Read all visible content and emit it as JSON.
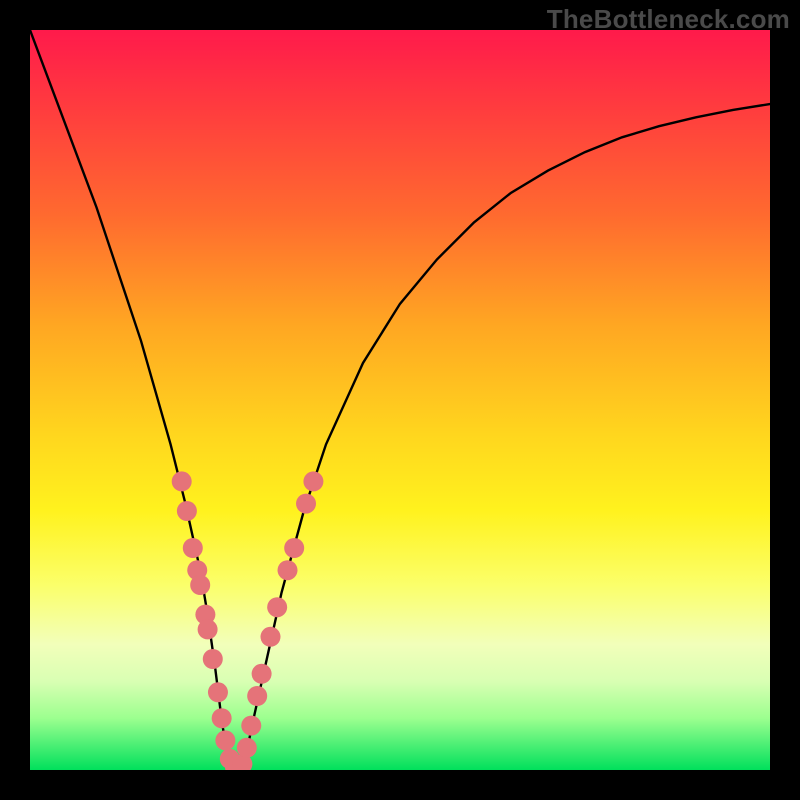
{
  "watermark": "TheBottleneck.com",
  "chart_data": {
    "type": "line",
    "title": "",
    "xlabel": "",
    "ylabel": "",
    "xlim": [
      0,
      100
    ],
    "ylim": [
      0,
      100
    ],
    "series": [
      {
        "name": "bottleneck-curve",
        "x": [
          0,
          3,
          6,
          9,
          12,
          15,
          17,
          19,
          21,
          23,
          24,
          25,
          26,
          27,
          28,
          29,
          30,
          32,
          34,
          37,
          40,
          45,
          50,
          55,
          60,
          65,
          70,
          75,
          80,
          85,
          90,
          95,
          100
        ],
        "y": [
          100,
          92,
          84,
          76,
          67,
          58,
          51,
          44,
          36,
          27,
          21,
          14,
          6,
          1,
          0,
          1,
          6,
          15,
          24,
          35,
          44,
          55,
          63,
          69,
          74,
          78,
          81,
          83.5,
          85.5,
          87,
          88.2,
          89.2,
          90
        ]
      }
    ],
    "markers": {
      "name": "highlight-dots",
      "color": "#e57379",
      "radius_px": 10,
      "points": [
        {
          "x": 20.5,
          "y": 39
        },
        {
          "x": 21.2,
          "y": 35
        },
        {
          "x": 22.0,
          "y": 30
        },
        {
          "x": 22.6,
          "y": 27
        },
        {
          "x": 23.0,
          "y": 25
        },
        {
          "x": 23.7,
          "y": 21
        },
        {
          "x": 24.0,
          "y": 19
        },
        {
          "x": 24.7,
          "y": 15
        },
        {
          "x": 25.4,
          "y": 10.5
        },
        {
          "x": 25.9,
          "y": 7
        },
        {
          "x": 26.4,
          "y": 4
        },
        {
          "x": 27.0,
          "y": 1.5
        },
        {
          "x": 27.7,
          "y": 0.4
        },
        {
          "x": 28.7,
          "y": 0.8
        },
        {
          "x": 29.3,
          "y": 3
        },
        {
          "x": 29.9,
          "y": 6
        },
        {
          "x": 30.7,
          "y": 10
        },
        {
          "x": 31.3,
          "y": 13
        },
        {
          "x": 32.5,
          "y": 18
        },
        {
          "x": 33.4,
          "y": 22
        },
        {
          "x": 34.8,
          "y": 27
        },
        {
          "x": 35.7,
          "y": 30
        },
        {
          "x": 37.3,
          "y": 36
        },
        {
          "x": 38.3,
          "y": 39
        }
      ]
    }
  }
}
